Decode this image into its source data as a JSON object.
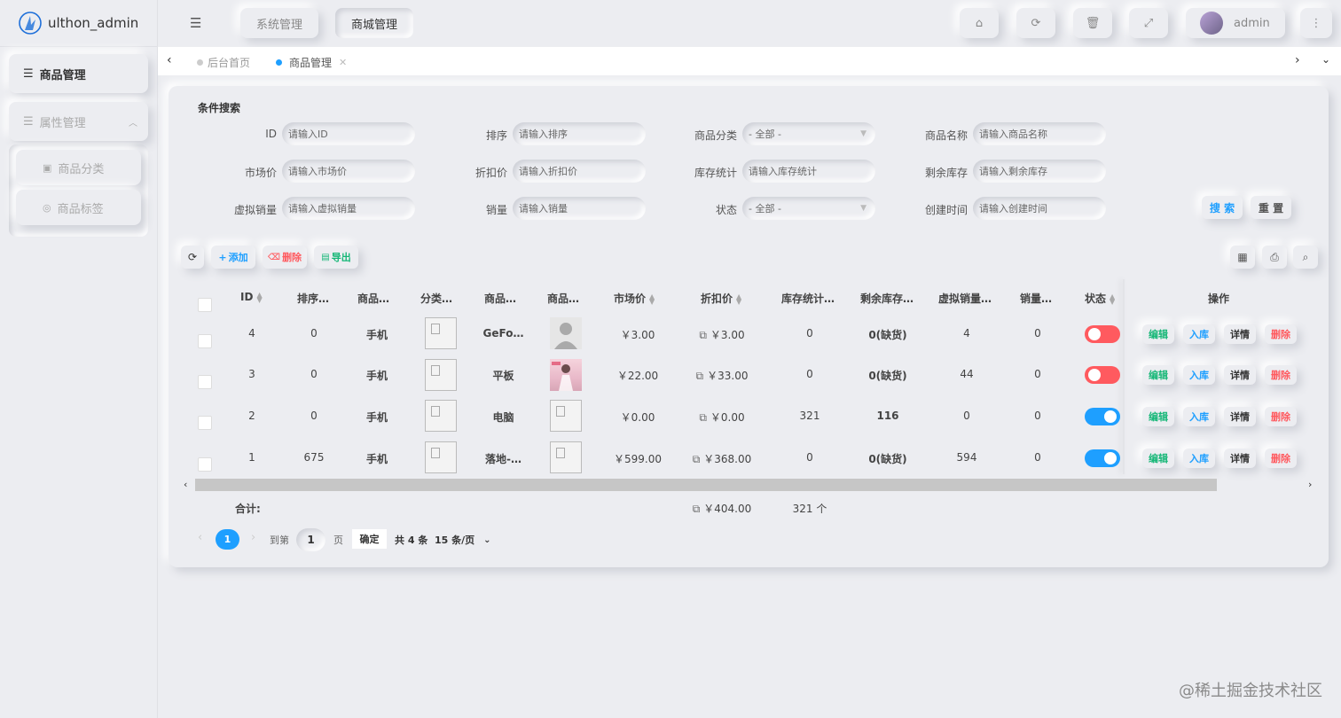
{
  "app": {
    "name": "ulthon_admin"
  },
  "header": {
    "tabs": [
      "系统管理",
      "商城管理"
    ],
    "user": "admin"
  },
  "sidebar": {
    "items": [
      {
        "label": "商品管理"
      },
      {
        "label": "属性管理"
      },
      {
        "label": "商品分类"
      },
      {
        "label": "商品标签"
      }
    ]
  },
  "tabbar": {
    "tabs": [
      "后台首页",
      "商品管理"
    ]
  },
  "search": {
    "title": "条件搜索",
    "fields": [
      {
        "label": "ID",
        "placeholder": "请输入ID"
      },
      {
        "label": "排序",
        "placeholder": "请输入排序"
      },
      {
        "label": "商品分类",
        "placeholder": "- 全部 -"
      },
      {
        "label": "商品名称",
        "placeholder": "请输入商品名称"
      },
      {
        "label": "市场价",
        "placeholder": "请输入市场价"
      },
      {
        "label": "折扣价",
        "placeholder": "请输入折扣价"
      },
      {
        "label": "库存统计",
        "placeholder": "请输入库存统计"
      },
      {
        "label": "剩余库存",
        "placeholder": "请输入剩余库存"
      },
      {
        "label": "虚拟销量",
        "placeholder": "请输入虚拟销量"
      },
      {
        "label": "销量",
        "placeholder": "请输入销量"
      },
      {
        "label": "状态",
        "placeholder": "- 全部 -"
      },
      {
        "label": "创建时间",
        "placeholder": "请输入创建时间"
      }
    ],
    "search_btn": "搜 索",
    "reset_btn": "重 置"
  },
  "toolbar": {
    "add": "添加",
    "delete": "删除",
    "export": "导出"
  },
  "table": {
    "headers": [
      "ID",
      "排序…",
      "商品…",
      "分类…",
      "商品…",
      "商品…",
      "市场价",
      "折扣价",
      "库存统计…",
      "剩余库存…",
      "虚拟销量…",
      "销量…",
      "状态",
      "操作"
    ],
    "rows": [
      {
        "id": "4",
        "sort": "0",
        "cate": "手机",
        "name": "GeFo…",
        "market": "￥3.00",
        "discount": "￥3.00",
        "stock": "0",
        "remain": "0(缺货)",
        "virtual": "4",
        "sales": "0",
        "status": false
      },
      {
        "id": "3",
        "sort": "0",
        "cate": "手机",
        "name": "平板",
        "market": "￥22.00",
        "discount": "￥33.00",
        "stock": "0",
        "remain": "0(缺货)",
        "virtual": "44",
        "sales": "0",
        "status": false
      },
      {
        "id": "2",
        "sort": "0",
        "cate": "手机",
        "name": "电脑",
        "market": "￥0.00",
        "discount": "￥0.00",
        "stock": "321",
        "remain": "116",
        "virtual": "0",
        "sales": "0",
        "status": true
      },
      {
        "id": "1",
        "sort": "675",
        "cate": "手机",
        "name": "落地-…",
        "market": "￥599.00",
        "discount": "￥368.00",
        "stock": "0",
        "remain": "0(缺货)",
        "virtual": "594",
        "sales": "0",
        "status": true
      }
    ],
    "actions": [
      "编辑",
      "入库",
      "详情",
      "删除"
    ],
    "total_label": "合计:",
    "total_discount": "￥404.00",
    "total_stock": "321 个"
  },
  "pager": {
    "current": "1",
    "goto_label": "到第",
    "goto_value": "1",
    "page_unit": "页",
    "confirm": "确定",
    "count": "共 4 条",
    "size": "15 条/页"
  },
  "watermark": "@稀土掘金技术社区",
  "colors": {
    "accent": "#1e9fff",
    "danger": "#ff5a5f",
    "success": "#16b777"
  }
}
